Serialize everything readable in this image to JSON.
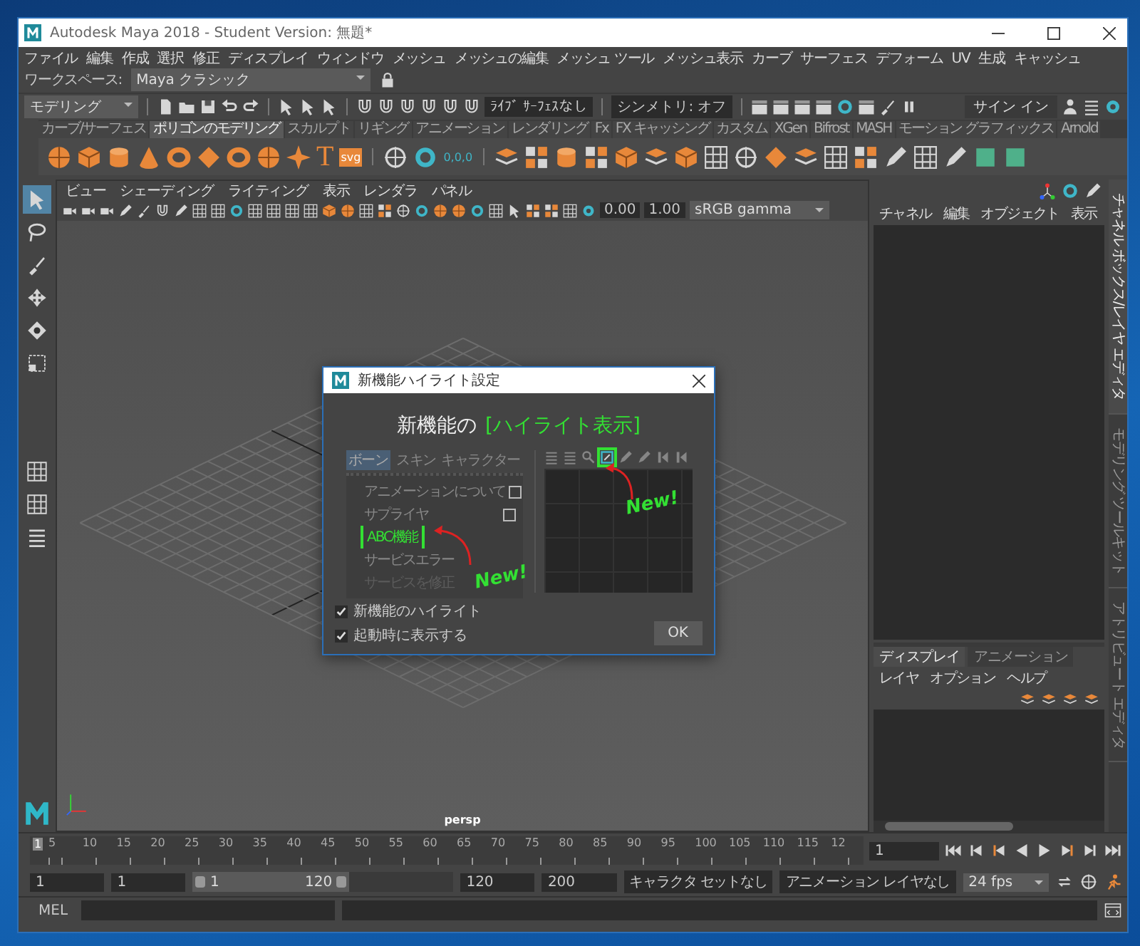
{
  "window": {
    "title": "Autodesk Maya 2018 - Student Version: 無題*"
  },
  "menu_bar": {
    "items": [
      "ファイル",
      "編集",
      "作成",
      "選択",
      "修正",
      "ディスプレイ",
      "ウィンドウ",
      "メッシュ",
      "メッシュの編集",
      "メッシュ ツール",
      "メッシュ表示",
      "カーブ",
      "サーフェス",
      "デフォーム",
      "UV",
      "生成",
      "キャッシュ"
    ],
    "workspace_label": "ワークスペース:",
    "workspace_value": "Maya クラシック"
  },
  "status_line": {
    "mode": "モデリング",
    "live_surface": "ﾗｲﾌﾞ ｻｰﾌｪｽなし",
    "symmetry": "シンメトリ: オフ",
    "sign_in": "サイン イン"
  },
  "shelf": {
    "tabs": [
      {
        "label": "カーブ/サーフェス",
        "selected": false
      },
      {
        "label": "ポリゴンのモデリング",
        "selected": true
      },
      {
        "label": "スカルプト",
        "selected": false
      },
      {
        "label": "リギング",
        "selected": false
      },
      {
        "label": "アニメーション",
        "selected": false
      },
      {
        "label": "レンダリング",
        "selected": false
      },
      {
        "label": "Fx",
        "selected": false
      },
      {
        "label": "FX キャッシング",
        "selected": false
      },
      {
        "label": "カスタム",
        "selected": false
      },
      {
        "label": "XGen",
        "selected": false
      },
      {
        "label": "Bifrost",
        "selected": false
      },
      {
        "label": "MASH",
        "selected": false
      },
      {
        "label": "モーション グラフィックス",
        "selected": false
      },
      {
        "label": "Arnold",
        "selected": false
      }
    ],
    "text_tool_glyph": "T",
    "svg_tool_label": "svg",
    "locator_label": "0,0,0"
  },
  "toolbox": {
    "tools": [
      {
        "kind": "select",
        "selected": true
      },
      {
        "kind": "lasso",
        "selected": false
      },
      {
        "kind": "paint",
        "selected": false
      },
      {
        "kind": "move",
        "selected": false
      },
      {
        "kind": "rotate",
        "selected": false
      },
      {
        "kind": "scale",
        "selected": false
      }
    ]
  },
  "viewport": {
    "menus": [
      "ビュー",
      "シェーディング",
      "ライティング",
      "表示",
      "レンダラ",
      "パネル"
    ],
    "exposure": "0.00",
    "gamma": "1.00",
    "color_space": "sRGB gamma",
    "camera": "persp"
  },
  "dialog": {
    "title": "新機能ハイライト設定",
    "heading": "新機能の",
    "heading_highlight": "[ハイライト表示]",
    "preview": {
      "tabs": [
        {
          "label": "ボーン",
          "selected": true
        },
        {
          "label": "スキン",
          "selected": false
        },
        {
          "label": "キャラクター",
          "selected": false
        }
      ],
      "items": [
        {
          "label": "アニメーションについて",
          "has_box": true,
          "highlighted": false,
          "faded": false
        },
        {
          "label": "サプライヤ",
          "has_box": true,
          "highlighted": false,
          "faded": false
        },
        {
          "label": "ABC機能",
          "has_box": false,
          "highlighted": true,
          "faded": false
        },
        {
          "label": "サービスエラー",
          "has_box": false,
          "highlighted": false,
          "faded": false
        },
        {
          "label": "サービスを修正",
          "has_box": false,
          "highlighted": false,
          "faded": true
        }
      ],
      "tools": [
        {
          "kind": "list",
          "highlighted": false
        },
        {
          "kind": "list",
          "highlighted": false
        },
        {
          "kind": "magnifier",
          "highlighted": false
        },
        {
          "kind": "frame",
          "highlighted": true
        },
        {
          "kind": "pencil",
          "highlighted": false
        },
        {
          "kind": "pencil",
          "highlighted": false
        },
        {
          "kind": "key",
          "highlighted": false
        },
        {
          "kind": "key",
          "highlighted": false
        }
      ],
      "left_callout": "New!",
      "right_callout": "New!"
    },
    "checkboxes": [
      {
        "label": "新機能のハイライト",
        "checked": true
      },
      {
        "label": "起動時に表示する",
        "checked": true
      }
    ],
    "ok_button": "OK"
  },
  "channel_box": {
    "menus": [
      "チャネル",
      "編集",
      "オブジェクト",
      "表示"
    ]
  },
  "layer_editor": {
    "tabs": [
      {
        "label": "ディスプレイ",
        "selected": true
      },
      {
        "label": "アニメーション",
        "selected": false
      }
    ],
    "menus": [
      "レイヤ",
      "オプション",
      "ヘルプ"
    ]
  },
  "side_tabs": [
    {
      "label": "チャネル ボックス/レイヤ エディタ",
      "selected": true
    },
    {
      "label": "モデリング ツールキット",
      "selected": false
    },
    {
      "label": "アトリビュート エディタ",
      "selected": false
    }
  ],
  "time_slider": {
    "level": 0,
    "current_frame_marker": "1",
    "ticks": [
      "5",
      "10",
      "15",
      "20",
      "25",
      "30",
      "35",
      "40",
      "45",
      "50",
      "55",
      "60",
      "65",
      "70",
      "75",
      "80",
      "85",
      "90",
      "95",
      "100",
      "105",
      "110",
      "115",
      "12"
    ],
    "current_frame": "1"
  },
  "range_slider": {
    "level": 0.6,
    "start": "1",
    "playback_start": "1",
    "range_start": "1",
    "range_end": "120",
    "playback_end": "120",
    "end": "200",
    "character_set": "キャラクタ セットなし",
    "anim_layer": "アニメーション レイヤなし",
    "fps": "24 fps"
  },
  "command_line": {
    "language": "MEL"
  }
}
